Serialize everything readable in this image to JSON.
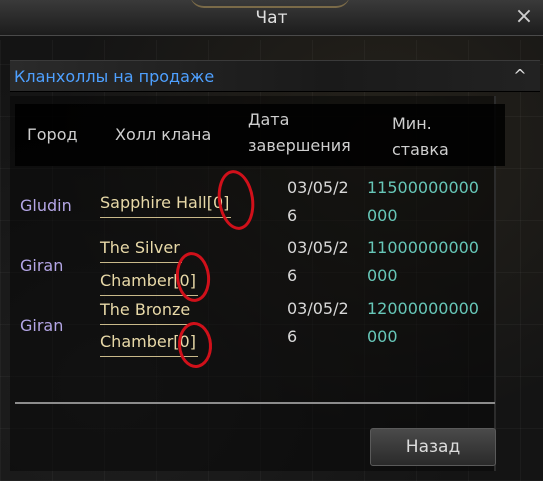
{
  "window": {
    "title": "Чат",
    "close_icon": "×"
  },
  "section": {
    "title": "Кланхоллы на продаже",
    "collapse_icon": "^"
  },
  "table": {
    "headers": {
      "city": "Город",
      "hall": "Холл клана",
      "end_date_line1": "Дата",
      "end_date_line2": "завершения",
      "min_bid_line1": "Мин.",
      "min_bid_line2": "ставка"
    },
    "rows": [
      {
        "city": "Gludin",
        "hall_line1": "Sapphire Hall[0]",
        "hall_line2": "",
        "date_line1": "03/05/2",
        "date_line2": "6",
        "bid_line1": "11500000000",
        "bid_line2": "000"
      },
      {
        "city": "Giran",
        "hall_line1": "The Silver",
        "hall_line2": "Chamber[0]",
        "date_line1": "03/05/2",
        "date_line2": "6",
        "bid_line1": "11000000000",
        "bid_line2": "000"
      },
      {
        "city": "Giran",
        "hall_line1": "The Bronze",
        "hall_line2": "Chamber[0]",
        "date_line1": "03/05/2",
        "date_line2": "6",
        "bid_line1": "12000000000",
        "bid_line2": "000"
      }
    ]
  },
  "footer": {
    "back_label": "Назад"
  },
  "colors": {
    "section_title": "#4ea0ff",
    "city": "#b4a6e6",
    "hall": "#e8d9a8",
    "bid": "#67c7b8",
    "annotation_circle": "#d0101a"
  }
}
